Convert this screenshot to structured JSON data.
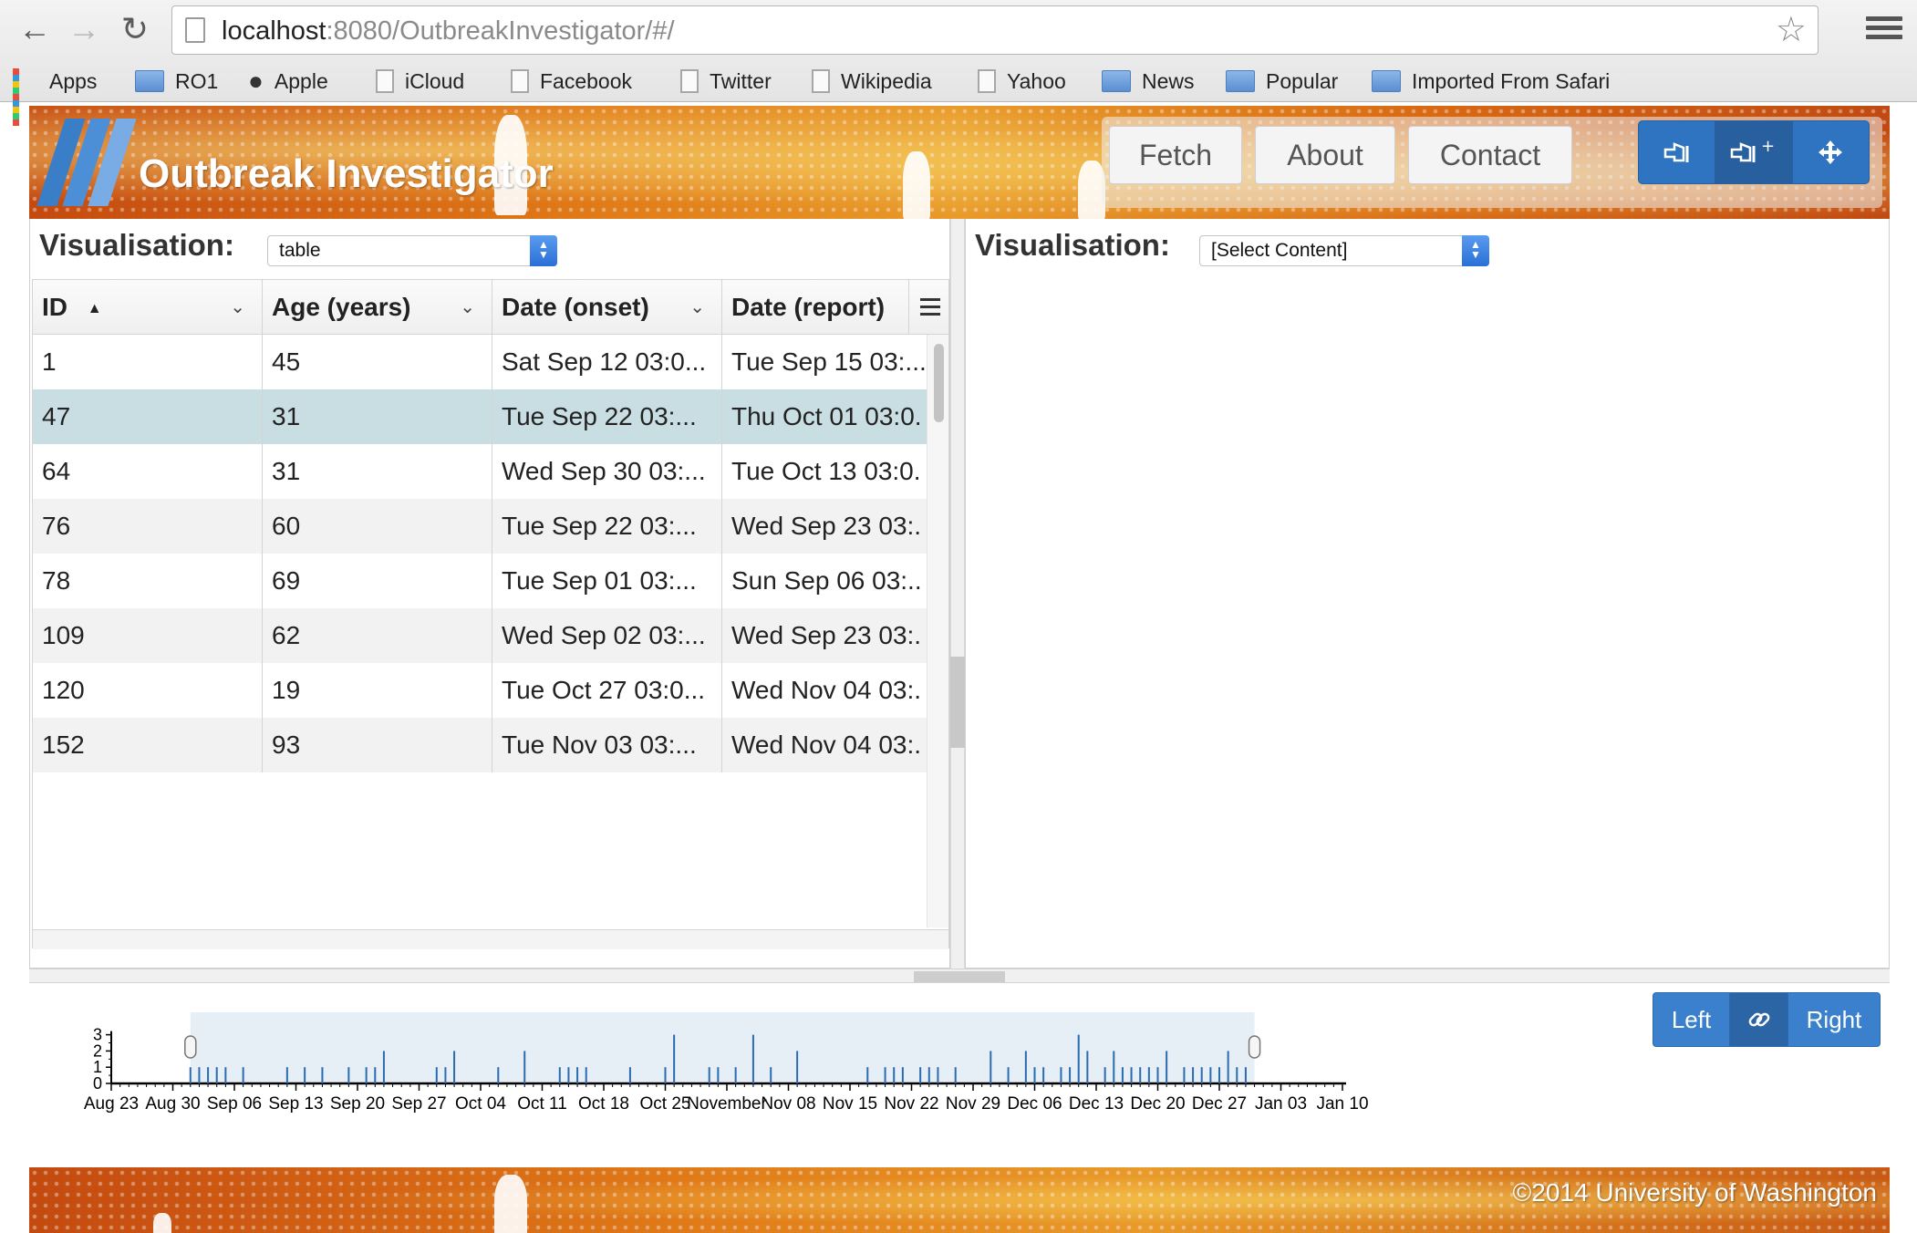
{
  "browser": {
    "url_host": "localhost",
    "url_rest": ":8080/OutbreakInvestigator/#/",
    "bookmarks": [
      {
        "label": "Apps",
        "icon": "apps-grid-icon"
      },
      {
        "label": "RO1",
        "icon": "folder-icon"
      },
      {
        "label": "Apple",
        "icon": "apple-icon"
      },
      {
        "label": "iCloud",
        "icon": "page-icon"
      },
      {
        "label": "Facebook",
        "icon": "page-icon"
      },
      {
        "label": "Twitter",
        "icon": "page-icon"
      },
      {
        "label": "Wikipedia",
        "icon": "page-icon"
      },
      {
        "label": "Yahoo",
        "icon": "page-icon"
      },
      {
        "label": "News",
        "icon": "folder-icon"
      },
      {
        "label": "Popular",
        "icon": "folder-icon"
      },
      {
        "label": "Imported From Safari",
        "icon": "folder-icon"
      }
    ]
  },
  "header": {
    "title": "Outbreak Investigator",
    "nav": [
      "Fetch",
      "About",
      "Contact"
    ],
    "tools": [
      "select-icon",
      "select-add-icon",
      "move-icon"
    ],
    "colors": {
      "accent": "#2f74c0",
      "banner": "#e07a18"
    }
  },
  "left_panel": {
    "vis_label": "Visualisation:",
    "vis_value": "table",
    "columns": [
      "ID",
      "Age (years)",
      "Date (onset)",
      "Date (report)"
    ],
    "sort_column": "ID",
    "sort_direction": "ascending",
    "selected_row": 1,
    "rows": [
      [
        "1",
        "45",
        "Sat Sep 12 03:0...",
        "Tue Sep 15 03:..."
      ],
      [
        "47",
        "31",
        "Tue Sep 22 03:...",
        "Thu Oct 01 03:0."
      ],
      [
        "64",
        "31",
        "Wed Sep 30 03:...",
        "Tue Oct 13 03:0."
      ],
      [
        "76",
        "60",
        "Tue Sep 22 03:...",
        "Wed Sep 23 03:."
      ],
      [
        "78",
        "69",
        "Tue Sep 01 03:...",
        "Sun Sep 06 03:.."
      ],
      [
        "109",
        "62",
        "Wed Sep 02 03:...",
        "Wed Sep 23 03:."
      ],
      [
        "120",
        "19",
        "Tue Oct 27 03:0...",
        "Wed Nov 04 03:."
      ],
      [
        "152",
        "93",
        "Tue Nov 03 03:...",
        "Wed Nov 04 03:."
      ]
    ]
  },
  "right_panel": {
    "vis_label": "Visualisation:",
    "vis_value": "[Select Content]"
  },
  "timeline": {
    "controls": {
      "left": "Left",
      "link_icon": "link-icon",
      "right": "Right"
    },
    "chart_data": {
      "type": "bar",
      "y_ticks": [
        "0",
        "1",
        "2",
        "3"
      ],
      "ylim": [
        0,
        3
      ],
      "x_tick_labels": [
        "Aug 23",
        "Aug 30",
        "Sep 06",
        "Sep 13",
        "Sep 20",
        "Sep 27",
        "Oct 04",
        "Oct 11",
        "Oct 18",
        "Oct 25",
        "November",
        "Nov 08",
        "Nov 15",
        "Nov 22",
        "Nov 29",
        "Dec 06",
        "Dec 13",
        "Dec 20",
        "Dec 27",
        "Jan 03",
        "Jan 10"
      ],
      "x_domain": [
        "2015-08-23",
        "2016-01-10"
      ],
      "brush_range": [
        "2015-09-01",
        "2015-12-31"
      ],
      "points": [
        {
          "x": "2015-09-01",
          "y": 1
        },
        {
          "x": "2015-09-02",
          "y": 1
        },
        {
          "x": "2015-09-03",
          "y": 1
        },
        {
          "x": "2015-09-04",
          "y": 1
        },
        {
          "x": "2015-09-05",
          "y": 1
        },
        {
          "x": "2015-09-07",
          "y": 1
        },
        {
          "x": "2015-09-12",
          "y": 1
        },
        {
          "x": "2015-09-14",
          "y": 1
        },
        {
          "x": "2015-09-16",
          "y": 1
        },
        {
          "x": "2015-09-19",
          "y": 1
        },
        {
          "x": "2015-09-21",
          "y": 1
        },
        {
          "x": "2015-09-22",
          "y": 1
        },
        {
          "x": "2015-09-23",
          "y": 2
        },
        {
          "x": "2015-09-29",
          "y": 1
        },
        {
          "x": "2015-09-30",
          "y": 1
        },
        {
          "x": "2015-10-01",
          "y": 2
        },
        {
          "x": "2015-10-06",
          "y": 1
        },
        {
          "x": "2015-10-09",
          "y": 2
        },
        {
          "x": "2015-10-13",
          "y": 1
        },
        {
          "x": "2015-10-14",
          "y": 1
        },
        {
          "x": "2015-10-15",
          "y": 1
        },
        {
          "x": "2015-10-16",
          "y": 1
        },
        {
          "x": "2015-10-21",
          "y": 1
        },
        {
          "x": "2015-10-25",
          "y": 1
        },
        {
          "x": "2015-10-26",
          "y": 3
        },
        {
          "x": "2015-10-30",
          "y": 1
        },
        {
          "x": "2015-10-31",
          "y": 1
        },
        {
          "x": "2015-11-02",
          "y": 1
        },
        {
          "x": "2015-11-04",
          "y": 3
        },
        {
          "x": "2015-11-06",
          "y": 1
        },
        {
          "x": "2015-11-09",
          "y": 2
        },
        {
          "x": "2015-11-17",
          "y": 1
        },
        {
          "x": "2015-11-19",
          "y": 1
        },
        {
          "x": "2015-11-20",
          "y": 1
        },
        {
          "x": "2015-11-21",
          "y": 1
        },
        {
          "x": "2015-11-23",
          "y": 1
        },
        {
          "x": "2015-11-24",
          "y": 1
        },
        {
          "x": "2015-11-25",
          "y": 1
        },
        {
          "x": "2015-11-27",
          "y": 1
        },
        {
          "x": "2015-12-01",
          "y": 2
        },
        {
          "x": "2015-12-03",
          "y": 1
        },
        {
          "x": "2015-12-05",
          "y": 2
        },
        {
          "x": "2015-12-06",
          "y": 1
        },
        {
          "x": "2015-12-07",
          "y": 1
        },
        {
          "x": "2015-12-09",
          "y": 1
        },
        {
          "x": "2015-12-10",
          "y": 1
        },
        {
          "x": "2015-12-11",
          "y": 3
        },
        {
          "x": "2015-12-12",
          "y": 2
        },
        {
          "x": "2015-12-14",
          "y": 1
        },
        {
          "x": "2015-12-15",
          "y": 2
        },
        {
          "x": "2015-12-16",
          "y": 1
        },
        {
          "x": "2015-12-17",
          "y": 1
        },
        {
          "x": "2015-12-18",
          "y": 1
        },
        {
          "x": "2015-12-19",
          "y": 1
        },
        {
          "x": "2015-12-20",
          "y": 1
        },
        {
          "x": "2015-12-21",
          "y": 2
        },
        {
          "x": "2015-12-23",
          "y": 1
        },
        {
          "x": "2015-12-24",
          "y": 1
        },
        {
          "x": "2015-12-25",
          "y": 1
        },
        {
          "x": "2015-12-26",
          "y": 1
        },
        {
          "x": "2015-12-27",
          "y": 1
        },
        {
          "x": "2015-12-28",
          "y": 2
        },
        {
          "x": "2015-12-29",
          "y": 1
        },
        {
          "x": "2015-12-30",
          "y": 1
        }
      ]
    }
  },
  "footer": {
    "copyright": "©2014 University of Washington"
  }
}
